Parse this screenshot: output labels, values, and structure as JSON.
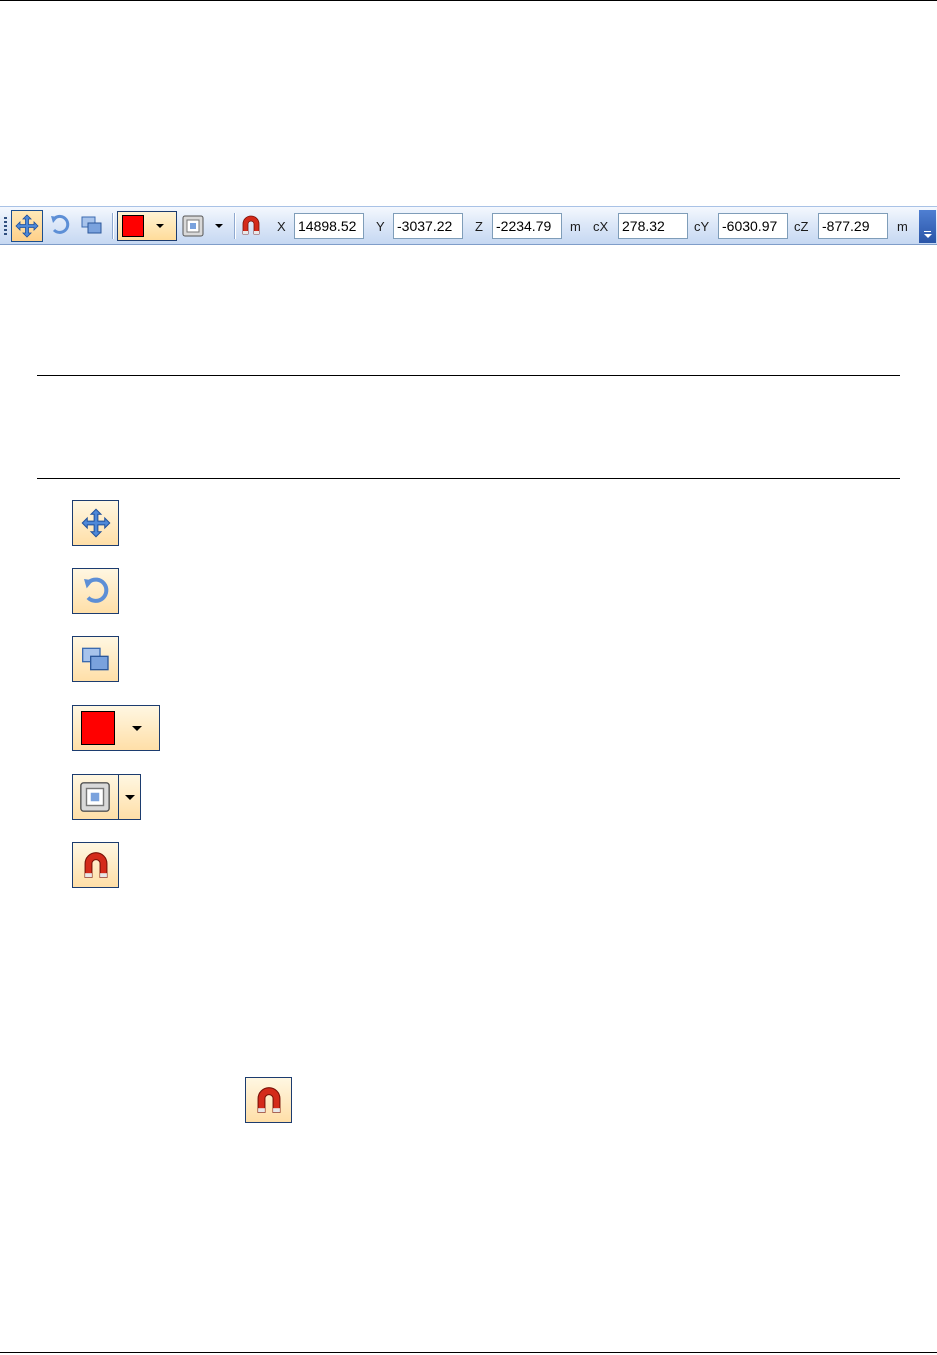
{
  "toolbar": {
    "fields": [
      {
        "label": "X",
        "value": "14898.52"
      },
      {
        "label": "Y",
        "value": "-3037.22"
      },
      {
        "label": "Z",
        "value": "-2234.79"
      },
      {
        "unit": "m"
      },
      {
        "label": "cX",
        "value": "278.32"
      },
      {
        "label": "cY",
        "value": "-6030.97"
      },
      {
        "label": "cZ",
        "value": "-877.29"
      },
      {
        "unit": "m"
      }
    ],
    "color_swatch": "#ff0000"
  },
  "icons": {
    "move": "move-icon",
    "rotate": "rotate-icon",
    "layer": "copy-icon",
    "color": "color-dropdown",
    "fill": "fill-style-icon",
    "snap": "magnet-icon"
  }
}
